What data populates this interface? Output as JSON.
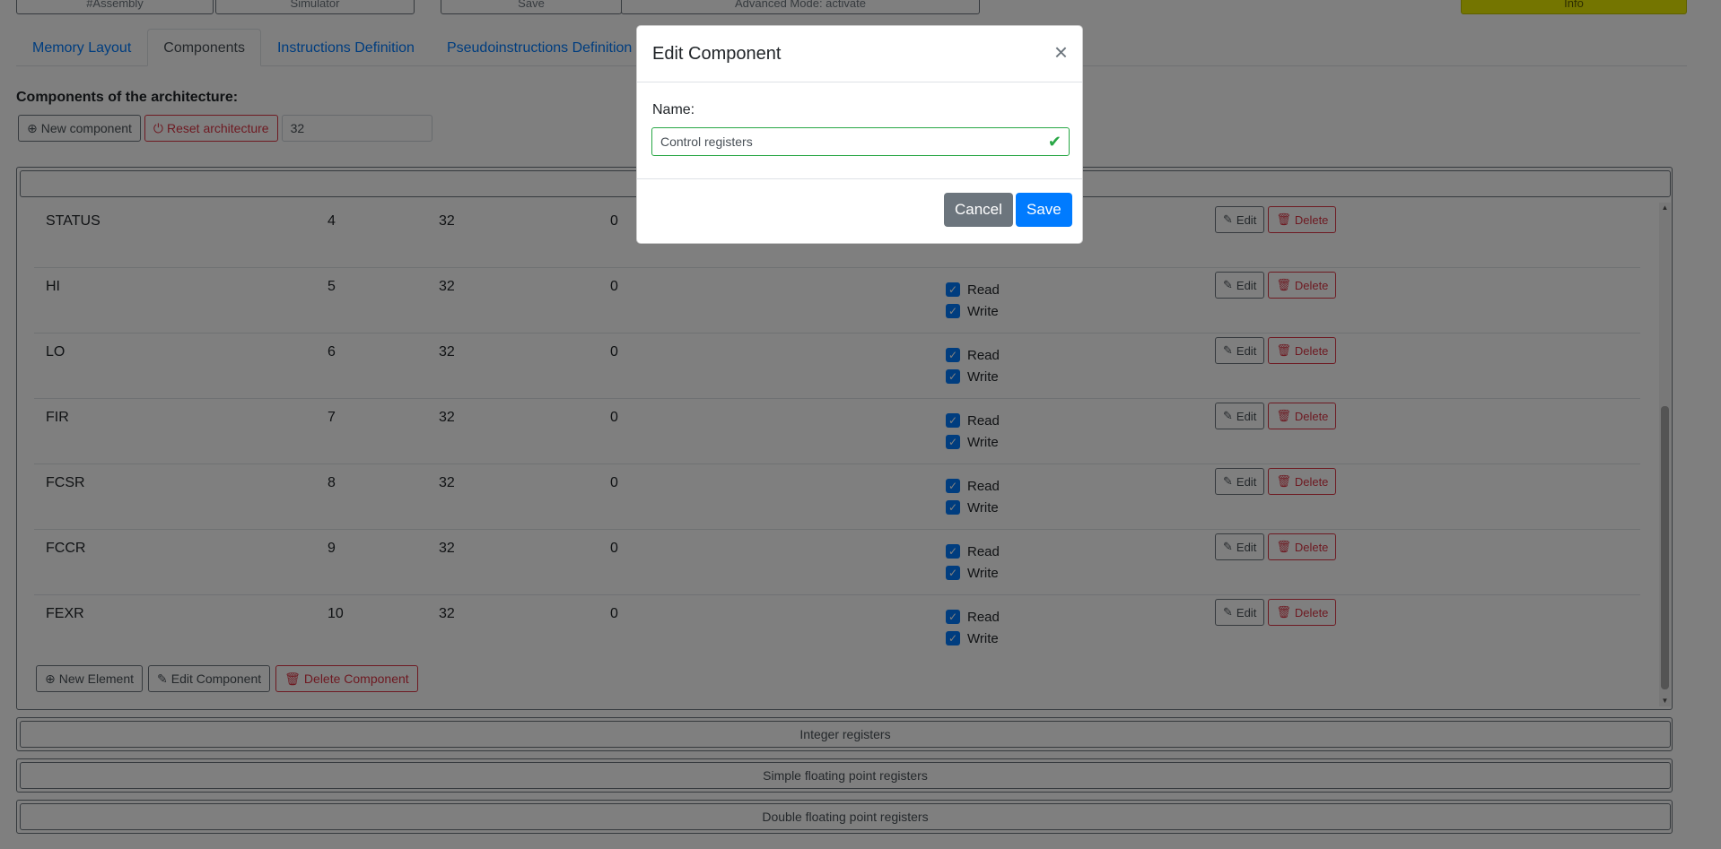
{
  "top_nav": {
    "assembly": "#Assembly",
    "simulator": "Simulator",
    "save": "Save",
    "advanced_mode": "Advanced Mode: activate",
    "info": "Info"
  },
  "tabs": [
    {
      "label": "Memory Layout"
    },
    {
      "label": "Components"
    },
    {
      "label": "Instructions Definition"
    },
    {
      "label": "Pseudoinstructions Definition"
    }
  ],
  "components_section": {
    "title": "Components of the architecture:",
    "new_component": "New component",
    "reset_architecture": "Reset architecture",
    "bits_value": "32"
  },
  "register_rows": [
    {
      "name": "STATUS",
      "id": "4",
      "bits": "32",
      "default": "0"
    },
    {
      "name": "HI",
      "id": "5",
      "bits": "32",
      "default": "0",
      "read": "Read",
      "write": "Write"
    },
    {
      "name": "LO",
      "id": "6",
      "bits": "32",
      "default": "0",
      "read": "Read",
      "write": "Write"
    },
    {
      "name": "FIR",
      "id": "7",
      "bits": "32",
      "default": "0",
      "read": "Read",
      "write": "Write"
    },
    {
      "name": "FCSR",
      "id": "8",
      "bits": "32",
      "default": "0",
      "read": "Read",
      "write": "Write"
    },
    {
      "name": "FCCR",
      "id": "9",
      "bits": "32",
      "default": "0",
      "read": "Read",
      "write": "Write"
    },
    {
      "name": "FEXR",
      "id": "10",
      "bits": "32",
      "default": "0",
      "read": "Read",
      "write": "Write"
    }
  ],
  "row_actions": {
    "edit": "Edit",
    "delete": "Delete"
  },
  "component_footer": {
    "new_element": "New Element",
    "edit_component": "Edit Component",
    "delete_component": "Delete Component"
  },
  "other_components": [
    "Integer registers",
    "Simple floating point registers",
    "Double floating point registers"
  ],
  "modal": {
    "title": "Edit Component",
    "close": "×",
    "name_label": "Name:",
    "name_value": "Control registers",
    "cancel": "Cancel",
    "save": "Save"
  }
}
